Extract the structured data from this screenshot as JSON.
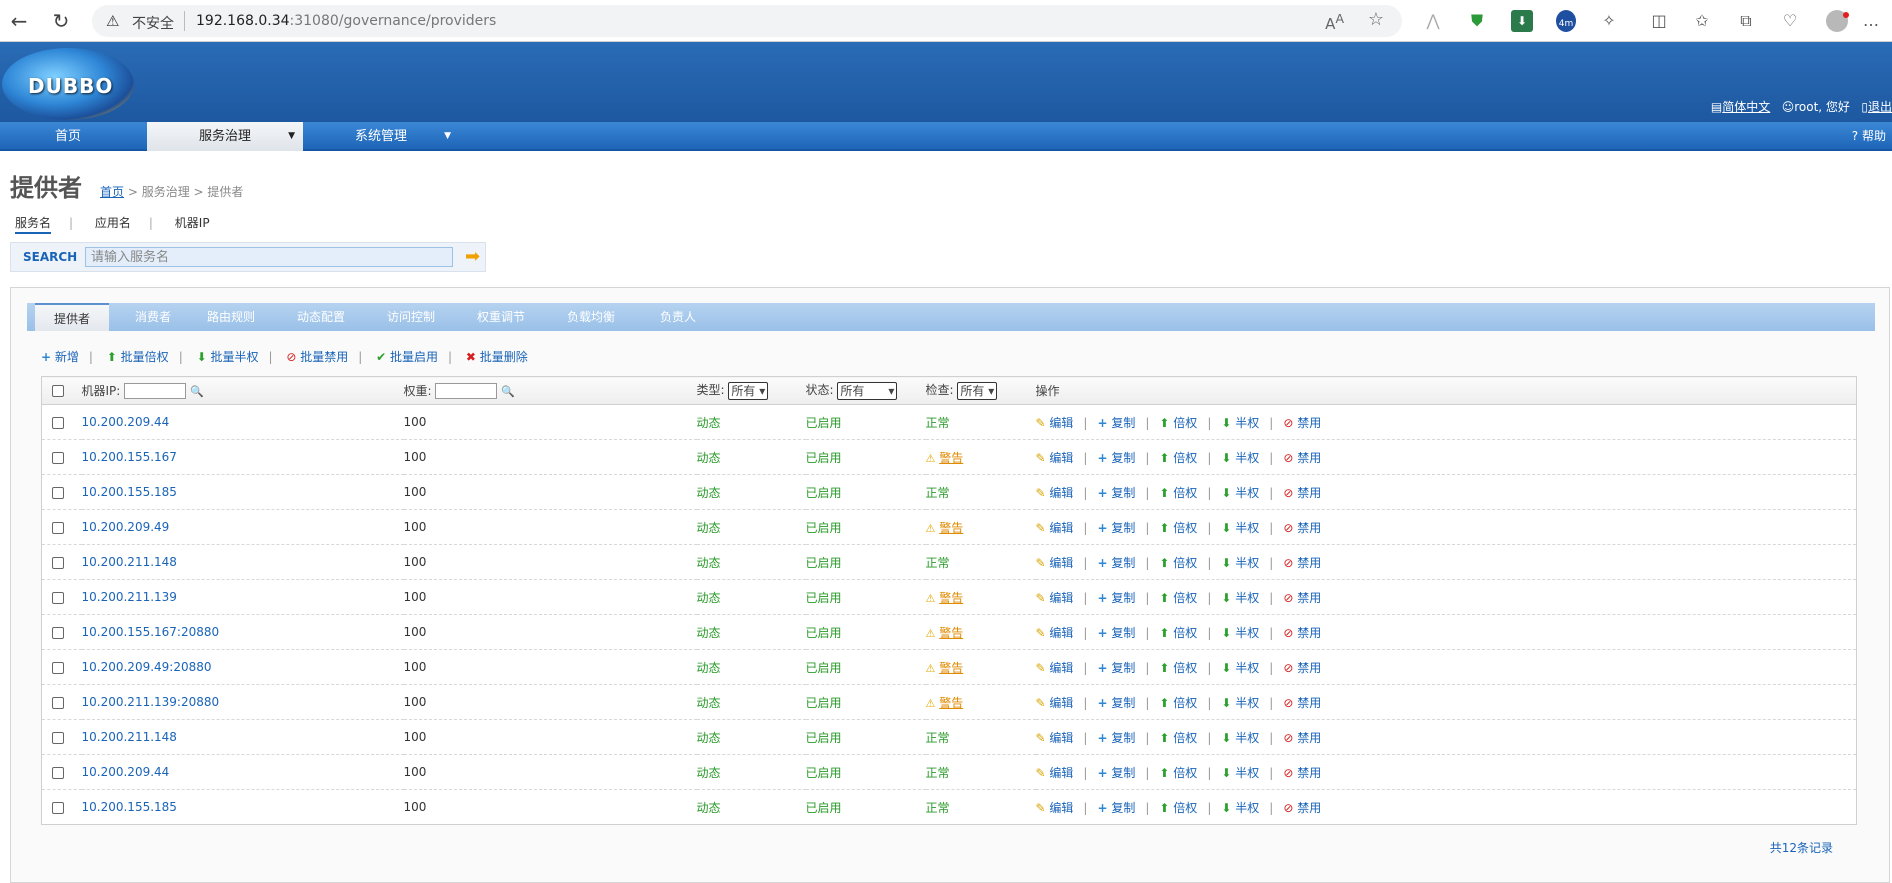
{
  "browser": {
    "back": "←",
    "reload": "↻",
    "insecure": "不安全",
    "url_host": "192.168.0.34",
    "url_rest": ":31080/governance/providers",
    "badge": "4m"
  },
  "header": {
    "logo_text": "DUBBO",
    "lang_link": "简体中文",
    "user_greeting": "root, 您好",
    "logout": "退出"
  },
  "menu": {
    "items": [
      {
        "label": "首页"
      },
      {
        "label": "服务治理"
      },
      {
        "label": "系统管理"
      }
    ],
    "help": "帮助"
  },
  "page": {
    "title": "提供者",
    "breadcrumb_home": "首页",
    "breadcrumb_rest": " > 服务治理 > 提供者"
  },
  "search": {
    "tabs": [
      "服务名",
      "应用名",
      "机器IP"
    ],
    "label": "SEARCH",
    "placeholder": "请输入服务名"
  },
  "subtabs": [
    "提供者",
    "消费者",
    "路由规则",
    "动态配置",
    "访问控制",
    "权重调节",
    "负载均衡",
    "负责人"
  ],
  "actions": {
    "add": "新增",
    "batch_double": "批量倍权",
    "batch_half": "批量半权",
    "batch_disable": "批量禁用",
    "batch_enable": "批量启用",
    "batch_delete": "批量删除"
  },
  "table": {
    "headers": {
      "ip": "机器IP:",
      "weight": "权重:",
      "type": "类型:",
      "status": "状态:",
      "check": "检查:",
      "ops": "操作"
    },
    "filter_default": "所有",
    "op_labels": {
      "edit": "编辑",
      "copy": "复制",
      "double": "倍权",
      "half": "半权",
      "disable": "禁用"
    },
    "rows": [
      {
        "ip": "10.200.209.44",
        "weight": "100",
        "type": "动态",
        "status": "已启用",
        "check": "正常",
        "warn": false
      },
      {
        "ip": "10.200.155.167",
        "weight": "100",
        "type": "动态",
        "status": "已启用",
        "check": "警告",
        "warn": true
      },
      {
        "ip": "10.200.155.185",
        "weight": "100",
        "type": "动态",
        "status": "已启用",
        "check": "正常",
        "warn": false
      },
      {
        "ip": "10.200.209.49",
        "weight": "100",
        "type": "动态",
        "status": "已启用",
        "check": "警告",
        "warn": true
      },
      {
        "ip": "10.200.211.148",
        "weight": "100",
        "type": "动态",
        "status": "已启用",
        "check": "正常",
        "warn": false
      },
      {
        "ip": "10.200.211.139",
        "weight": "100",
        "type": "动态",
        "status": "已启用",
        "check": "警告",
        "warn": true
      },
      {
        "ip": "10.200.155.167:20880",
        "weight": "100",
        "type": "动态",
        "status": "已启用",
        "check": "警告",
        "warn": true
      },
      {
        "ip": "10.200.209.49:20880",
        "weight": "100",
        "type": "动态",
        "status": "已启用",
        "check": "警告",
        "warn": true
      },
      {
        "ip": "10.200.211.139:20880",
        "weight": "100",
        "type": "动态",
        "status": "已启用",
        "check": "警告",
        "warn": true
      },
      {
        "ip": "10.200.211.148",
        "weight": "100",
        "type": "动态",
        "status": "已启用",
        "check": "正常",
        "warn": false
      },
      {
        "ip": "10.200.209.44",
        "weight": "100",
        "type": "动态",
        "status": "已启用",
        "check": "正常",
        "warn": false
      },
      {
        "ip": "10.200.155.185",
        "weight": "100",
        "type": "动态",
        "status": "已启用",
        "check": "正常",
        "warn": false
      }
    ],
    "total": "共12条记录"
  }
}
